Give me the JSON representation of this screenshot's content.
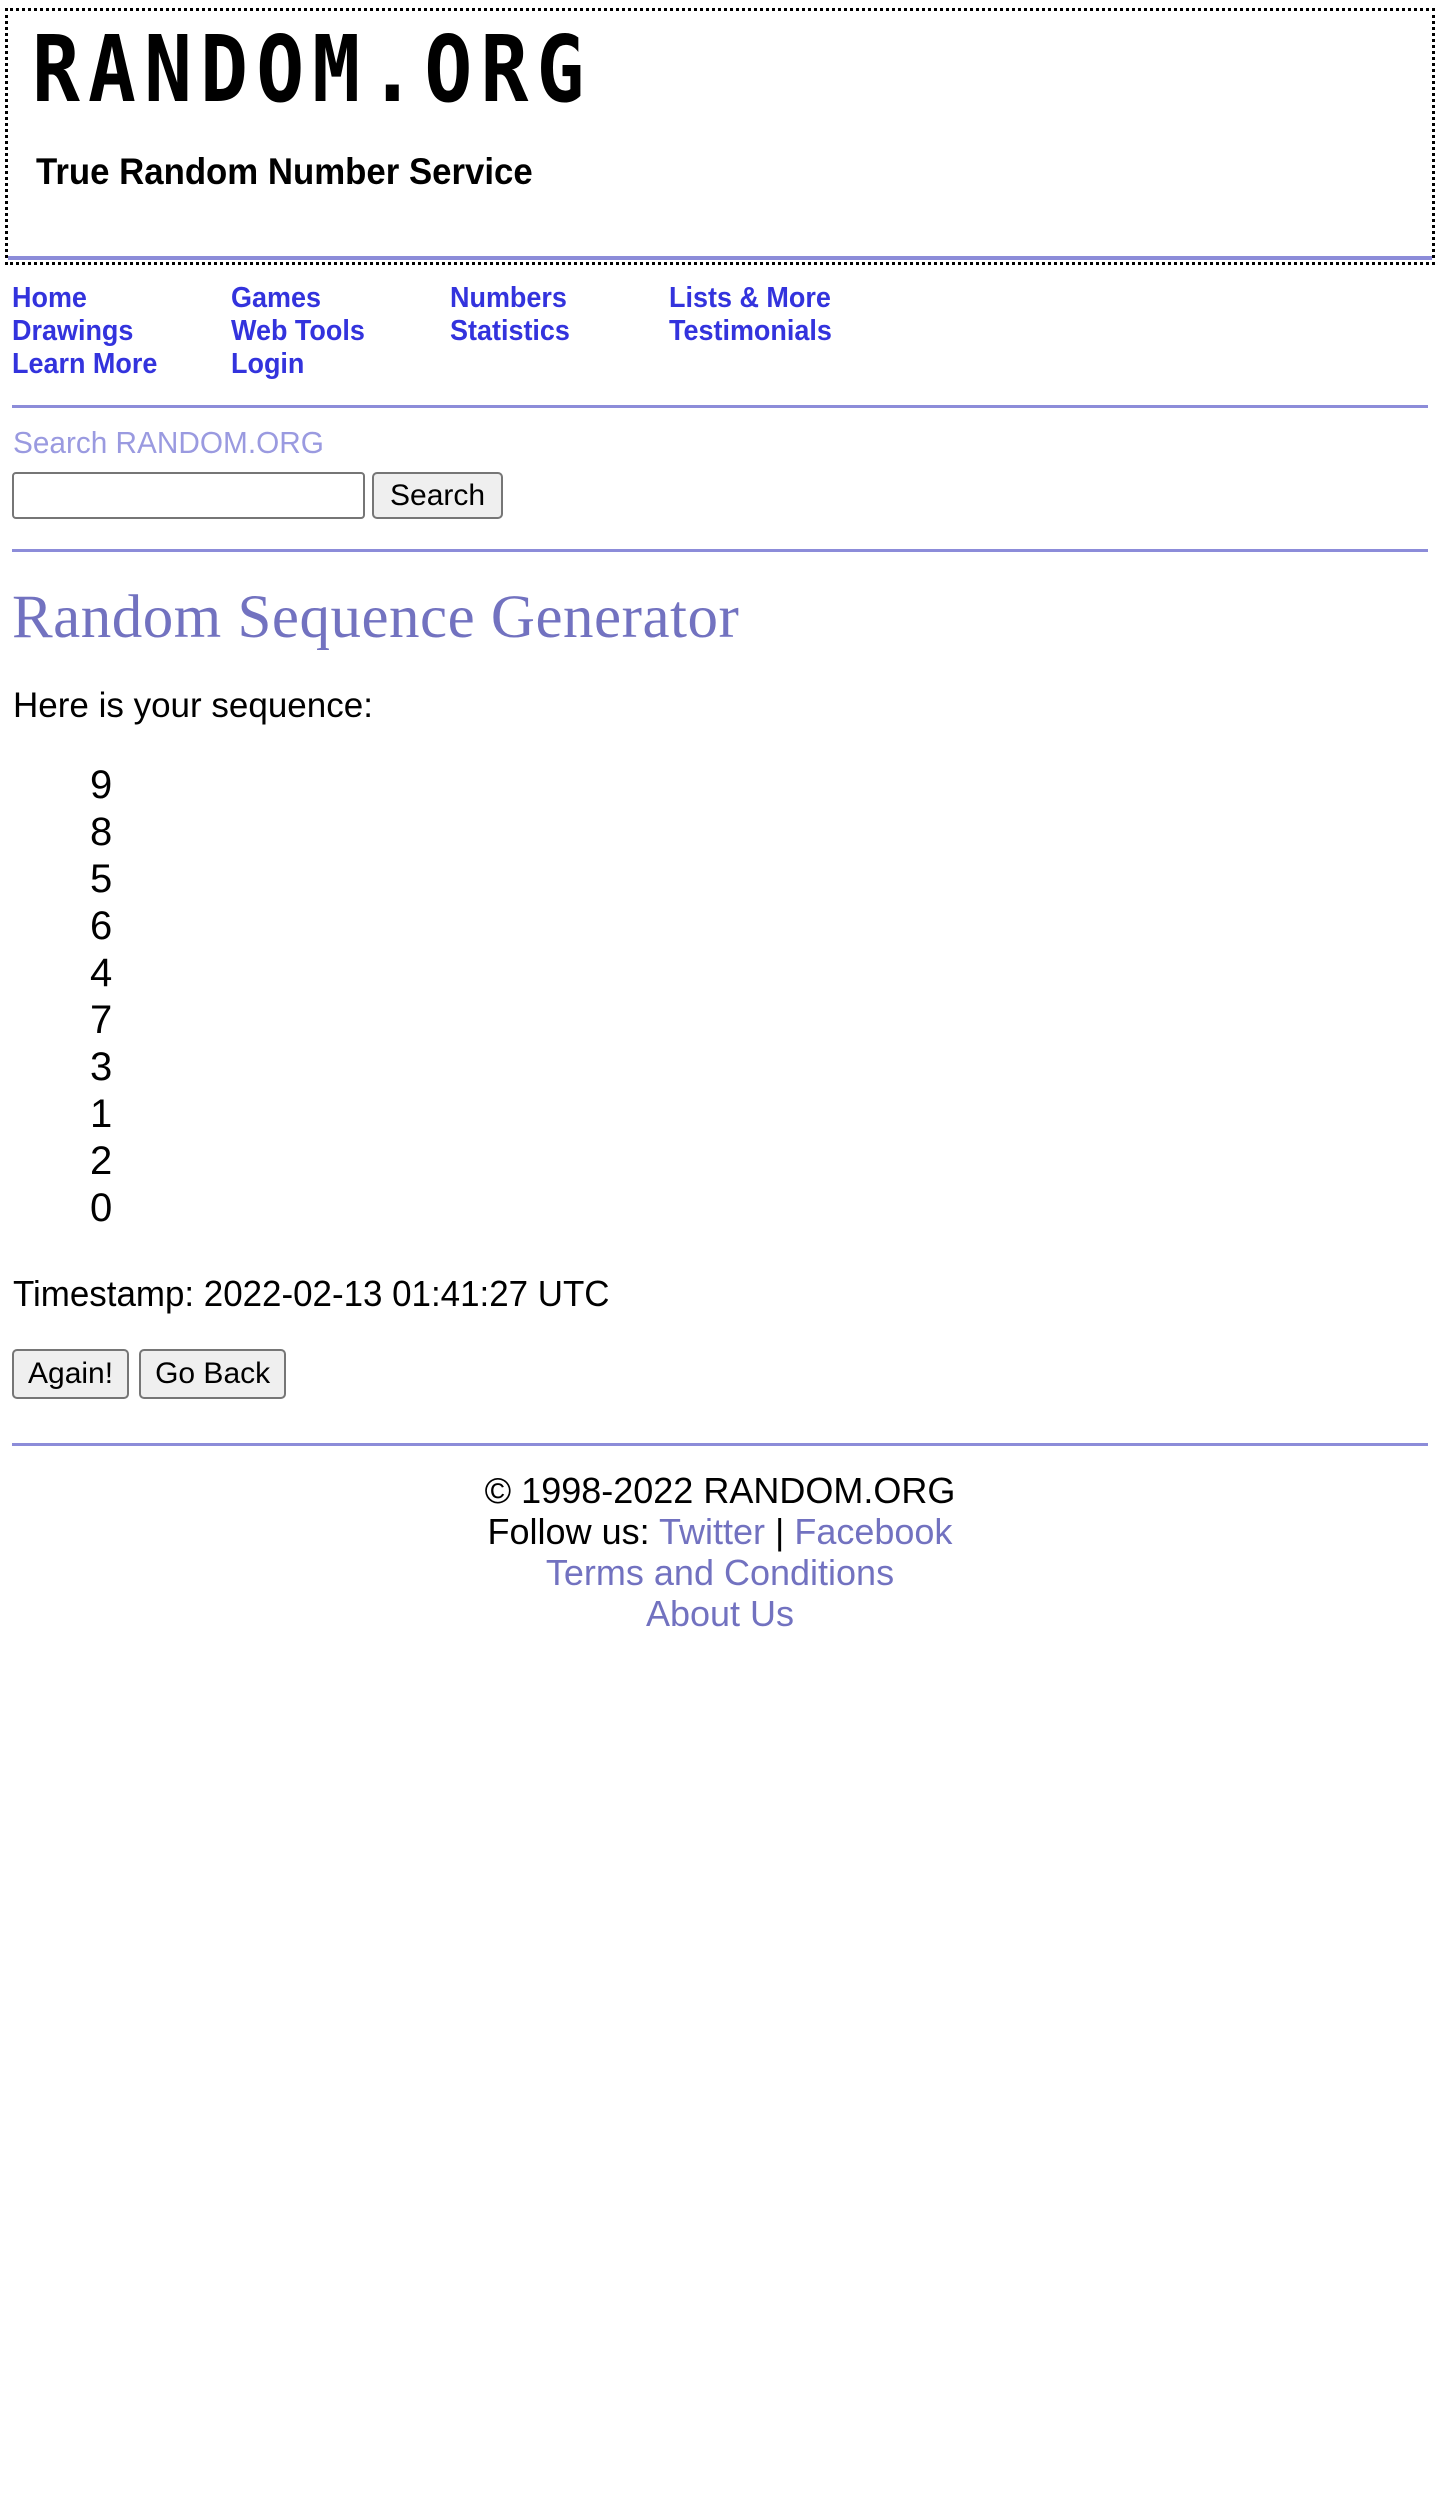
{
  "header": {
    "logo_text": "RANDOM.ORG",
    "tagline": "True Random Number Service"
  },
  "nav": {
    "rows": [
      [
        {
          "label": "Home"
        },
        {
          "label": "Games"
        },
        {
          "label": "Numbers"
        },
        {
          "label": "Lists & More"
        }
      ],
      [
        {
          "label": "Drawings"
        },
        {
          "label": "Web Tools"
        },
        {
          "label": "Statistics"
        },
        {
          "label": "Testimonials"
        }
      ],
      [
        {
          "label": "Learn More"
        },
        {
          "label": "Login"
        }
      ]
    ]
  },
  "search": {
    "label": "Search RANDOM.ORG",
    "value": "",
    "placeholder": "",
    "button_label": "Search"
  },
  "main": {
    "title": "Random Sequence Generator",
    "lead": "Here is your sequence:",
    "sequence": [
      "9",
      "8",
      "5",
      "6",
      "4",
      "7",
      "3",
      "1",
      "2",
      "0"
    ],
    "timestamp": "Timestamp: 2022-02-13 01:41:27 UTC",
    "again_label": "Again!",
    "go_back_label": "Go Back"
  },
  "footer": {
    "copyright": "© 1998-2022 RANDOM.ORG",
    "follow_prefix": "Follow us: ",
    "twitter": "Twitter",
    "separator": " | ",
    "facebook": "Facebook",
    "terms": "Terms and Conditions",
    "about": "About Us"
  },
  "colors": {
    "link_blue": "#3333dd",
    "accent_purple": "#8c8cd9",
    "title_purple": "#7272c0",
    "muted_purple": "#9a9ae0"
  }
}
